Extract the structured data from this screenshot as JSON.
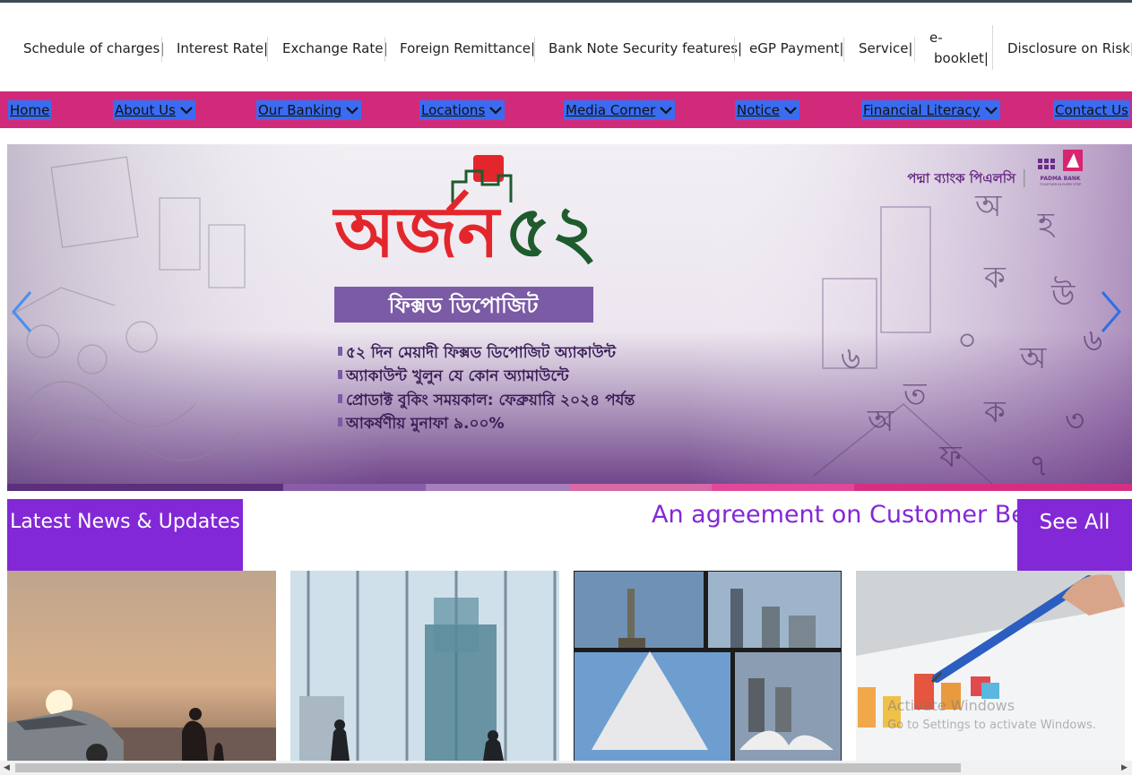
{
  "quick_links": {
    "schedule": "Schedule of charges|",
    "interest": "Interest Rate|",
    "exchange": "Exchange Rate|",
    "remittance": "Foreign Remittance|",
    "banknote": "Bank Note Security features|",
    "egp": "eGP Payment|",
    "service": "Service|",
    "ebook_1": "e-",
    "ebook_2": "booklet|",
    "disclosure": "Disclosure on Risk|"
  },
  "nav": {
    "home": "Home",
    "about": "About Us",
    "banking": "Our Banking",
    "locations": "Locations",
    "media": "Media Corner",
    "notice": "Notice",
    "literacy": "Financial Literacy",
    "contact": "Contact Us"
  },
  "banner": {
    "brand_bn": "পদ্মা ব্যাংক পিএলসি",
    "brand_en": "PADMA BANK",
    "brand_tagline": "TOGETHER IN EVERY STEP",
    "headline_bn": "অর্জন",
    "headline_num": "৫২",
    "product_bn": "ফিক্সড ডিপোজিট",
    "bullets": [
      "৫২ দিন মেয়াদী ফিক্সড ডিপোজিট অ্যাকাউন্ট",
      "অ্যাকাউন্ট খুলুন যে কোন অ্যামাউন্টে",
      "প্রোডাক্ট বুকিং সময়কাল: ফেব্রুয়ারি ২০২৪ পর্যন্ত",
      "আকর্ষণীয় মুনাফা ৯.০০%"
    ],
    "slide_active_index": 0,
    "slide_count": 6
  },
  "news": {
    "label": "Latest News & Updates",
    "ticker": "An agreement on Customer Be",
    "see_all": "See All"
  },
  "watermark": {
    "line1": "Activate Windows",
    "line2": "Go to Settings to activate Windows."
  },
  "colors": {
    "nav_bg": "#d22a7a",
    "nav_item_bg": "#3a6cf2",
    "accent_purple": "#8328d6",
    "banner_red": "#e3262c",
    "banner_green": "#1e5b2d",
    "banner_purple": "#7b4fa6"
  },
  "icons": {
    "nav_dropdown": "chevron-down-icon",
    "slider_prev": "chevron-left-icon",
    "slider_next": "chevron-right-icon"
  }
}
